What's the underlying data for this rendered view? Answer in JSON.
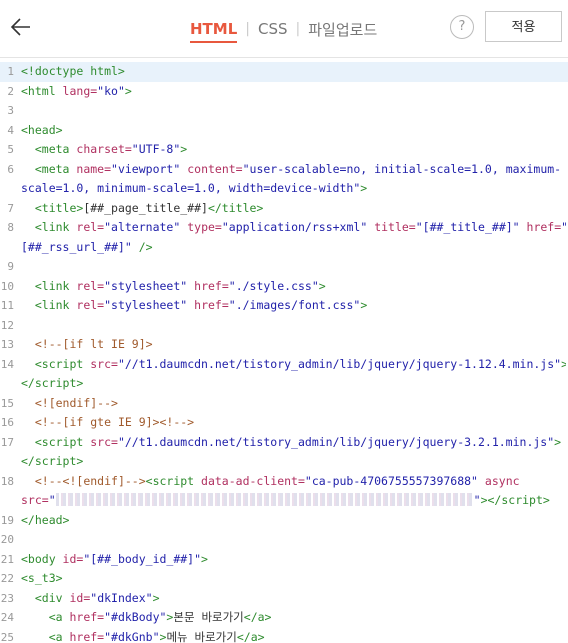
{
  "header": {
    "tabs": [
      {
        "label": "HTML",
        "active": true
      },
      {
        "label": "CSS",
        "active": false
      },
      {
        "label": "파일업로드",
        "active": false
      }
    ],
    "help_label": "?",
    "apply_label": "적용"
  },
  "editor": {
    "lines": [
      {
        "n": "1",
        "html": "<span class=\"g\">&lt;!doctype html&gt;</span>"
      },
      {
        "n": "2",
        "html": "<span class=\"g\">&lt;html </span><span class=\"r\">lang=</span><span class=\"s\">\"ko\"</span><span class=\"g\">&gt;</span>"
      },
      {
        "n": "3",
        "html": ""
      },
      {
        "n": "4",
        "html": "<span class=\"g\">&lt;head&gt;</span>"
      },
      {
        "n": "5",
        "html": "  <span class=\"g\">&lt;meta </span><span class=\"r\">charset=</span><span class=\"s\">\"UTF-8\"</span><span class=\"g\">&gt;</span>"
      },
      {
        "n": "6",
        "html": "  <span class=\"g\">&lt;meta </span><span class=\"r\">name=</span><span class=\"s\">\"viewport\"</span> <span class=\"r\">content=</span><span class=\"s\">\"user-scalable=no, initial-scale=1.0, maximum-</span>"
      },
      {
        "n": "",
        "html": "<span class=\"s\">scale=1.0, minimum-scale=1.0, width=device-width\"</span><span class=\"g\">&gt;</span>"
      },
      {
        "n": "7",
        "html": "  <span class=\"g\">&lt;title&gt;</span>[##_page_title_##]<span class=\"g\">&lt;/title&gt;</span>"
      },
      {
        "n": "8",
        "html": "  <span class=\"g\">&lt;link </span><span class=\"r\">rel=</span><span class=\"s\">\"alternate\"</span> <span class=\"r\">type=</span><span class=\"s\">\"application/rss+xml\"</span> <span class=\"r\">title=</span><span class=\"s\">\"[##_title_##]\"</span> <span class=\"r\">href=</span><span class=\"s\">\"</span>"
      },
      {
        "n": "",
        "html": "<span class=\"s\">[##_rss_url_##]\"</span> <span class=\"g\">/&gt;</span>"
      },
      {
        "n": "9",
        "html": ""
      },
      {
        "n": "10",
        "html": "  <span class=\"g\">&lt;link </span><span class=\"r\">rel=</span><span class=\"s\">\"stylesheet\"</span> <span class=\"r\">href=</span><span class=\"s\">\"./style.css\"</span><span class=\"g\">&gt;</span>"
      },
      {
        "n": "11",
        "html": "  <span class=\"g\">&lt;link </span><span class=\"r\">rel=</span><span class=\"s\">\"stylesheet\"</span> <span class=\"r\">href=</span><span class=\"s\">\"./images/font.css\"</span><span class=\"g\">&gt;</span>"
      },
      {
        "n": "12",
        "html": ""
      },
      {
        "n": "13",
        "html": "  <span class=\"c\">&lt;!--[if lt IE 9]&gt;</span>"
      },
      {
        "n": "14",
        "html": "  <span class=\"g\">&lt;script </span><span class=\"r\">src=</span><span class=\"s\">\"//t1.daumcdn.net/tistory_admin/lib/jquery/jquery-1.12.4.min.js\"</span><span class=\"g\">&gt;</span>"
      },
      {
        "n": "",
        "html": "<span class=\"g\">&lt;/script&gt;</span>"
      },
      {
        "n": "15",
        "html": "  <span class=\"c\">&lt;![endif]--&gt;</span>"
      },
      {
        "n": "16",
        "html": "  <span class=\"c\">&lt;!--[if gte IE 9]&gt;&lt;!--&gt;</span>"
      },
      {
        "n": "17",
        "html": "  <span class=\"g\">&lt;script </span><span class=\"r\">src=</span><span class=\"s\">\"//t1.daumcdn.net/tistory_admin/lib/jquery/jquery-3.2.1.min.js\"</span><span class=\"g\">&gt;</span>"
      },
      {
        "n": "",
        "html": "<span class=\"g\">&lt;/script&gt;</span>"
      },
      {
        "n": "18",
        "html": "  <span class=\"c\">&lt;!--&lt;![endif]--&gt;</span><span class=\"g\">&lt;script </span><span class=\"r\">data-ad-client=</span><span class=\"s\">\"ca-pub-4706755557397688\"</span> <span class=\"r\">async</span>"
      },
      {
        "n": "",
        "html": "<span class=\"r\">src=</span><span class=\"s\">\"</span><span class=\"blur\"></span><span class=\"s\">\"</span><span class=\"g\">&gt;&lt;/script&gt;</span>"
      },
      {
        "n": "19",
        "html": "<span class=\"g\">&lt;/head&gt;</span>"
      },
      {
        "n": "20",
        "html": ""
      },
      {
        "n": "21",
        "html": "<span class=\"g\">&lt;body </span><span class=\"r\">id=</span><span class=\"s\">\"[##_body_id_##]\"</span><span class=\"g\">&gt;</span>"
      },
      {
        "n": "22",
        "html": "<span class=\"g\">&lt;s_t3&gt;</span>"
      },
      {
        "n": "23",
        "html": "  <span class=\"g\">&lt;div </span><span class=\"r\">id=</span><span class=\"s\">\"dkIndex\"</span><span class=\"g\">&gt;</span>"
      },
      {
        "n": "24",
        "html": "    <span class=\"g\">&lt;a </span><span class=\"r\">href=</span><span class=\"s\">\"#dkBody\"</span><span class=\"g\">&gt;</span>본문 바로가기<span class=\"g\">&lt;/a&gt;</span>"
      },
      {
        "n": "25",
        "html": "    <span class=\"g\">&lt;a </span><span class=\"r\">href=</span><span class=\"s\">\"#dkGnb\"</span><span class=\"g\">&gt;</span>메뉴 바로가기<span class=\"g\">&lt;/a&gt;</span>"
      }
    ]
  }
}
